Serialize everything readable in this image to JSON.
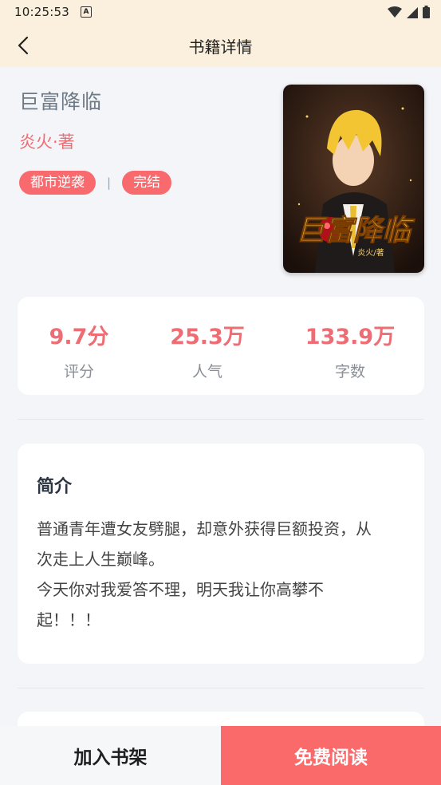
{
  "status_bar": {
    "time": "10:25:53",
    "notif_glyph": "A"
  },
  "nav": {
    "title": "书籍详情"
  },
  "book": {
    "title": "巨富降临",
    "author": "炎火·著",
    "tags": [
      "都市逆袭",
      "完结"
    ],
    "tag_separator": "|",
    "cover": {
      "title_text": "巨富降临",
      "author_text": "炎火/著"
    }
  },
  "stats": [
    {
      "value": "9.7分",
      "label": "评分"
    },
    {
      "value": "25.3万",
      "label": "人气"
    },
    {
      "value": "133.9万",
      "label": "字数"
    }
  ],
  "intro": {
    "title": "简介",
    "lines": [
      "普通青年遭女友劈腿，却意外获得巨额投资，从",
      "次走上人生巅峰。",
      "今天你对我爱答不理，明天我让你高攀不",
      "起！！！"
    ]
  },
  "actions": {
    "add_shelf": "加入书架",
    "read_free": "免费阅读"
  },
  "colors": {
    "accent": "#fa6a6b",
    "header_bg": "#fbf0dd",
    "page_bg": "#f4f5f8"
  }
}
